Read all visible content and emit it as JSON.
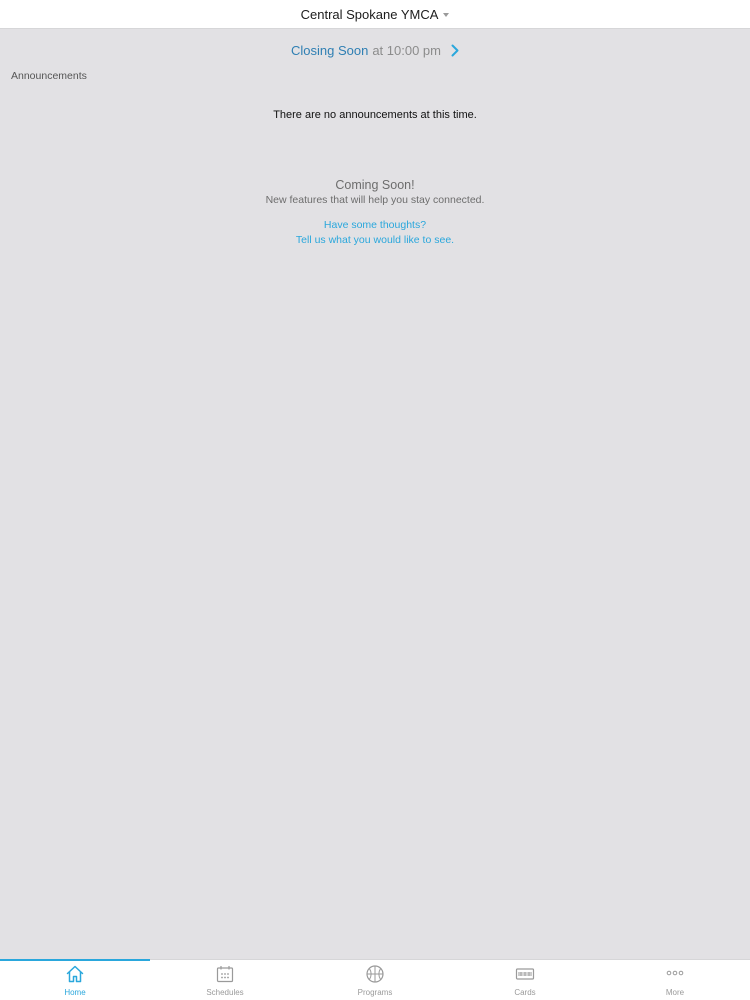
{
  "header": {
    "location_title": "Central Spokane YMCA"
  },
  "closing_banner": {
    "status": "Closing Soon",
    "time_text": "at 10:00 pm"
  },
  "announcements": {
    "section_label": "Announcements",
    "empty_message": "There are no announcements at this time."
  },
  "coming_soon": {
    "title": "Coming Soon!",
    "subtitle": "New features that will help you stay connected.",
    "feedback_line1": "Have some thoughts?",
    "feedback_line2": "Tell us what you would like to see."
  },
  "tabbar": {
    "tabs": [
      {
        "label": "Home",
        "icon": "home-icon",
        "active": true
      },
      {
        "label": "Schedules",
        "icon": "calendar-icon",
        "active": false
      },
      {
        "label": "Programs",
        "icon": "basketball-icon",
        "active": false
      },
      {
        "label": "Cards",
        "icon": "card-icon",
        "active": false
      },
      {
        "label": "More",
        "icon": "more-dots-icon",
        "active": false
      }
    ]
  },
  "colors": {
    "accent": "#2aa7dc",
    "closing_status": "#2f7fb3",
    "background": "#e2e1e4",
    "inactive_tab": "#9a9a9a"
  }
}
